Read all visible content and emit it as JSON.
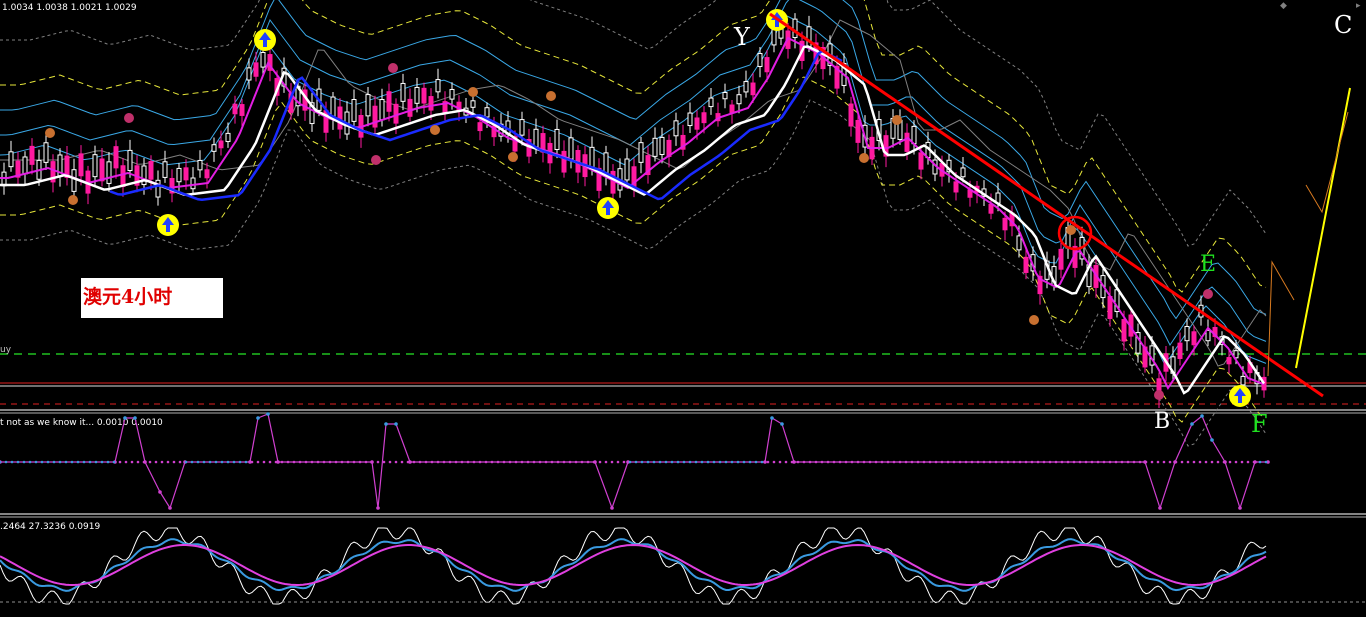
{
  "header": {
    "ohlc": "1.0034 1.0038 1.0021 1.0029"
  },
  "annotation_box": {
    "label": "澳元4小时"
  },
  "wave_labels": {
    "Y": "Y",
    "C": "C",
    "E": "E",
    "B": "B",
    "F": "F"
  },
  "level_label": "uy",
  "indicator1": {
    "title": "t not as we know it...  0.0010 0.0010"
  },
  "indicator2": {
    "title": ".2464 27.3236 0.0919"
  },
  "colors": {
    "bull_candle": "#ffffff",
    "bear_candle": "#ff1aa0",
    "ma_white": "#ffffff",
    "ma_magenta": "#e21ee2",
    "ma_blue": "#1a2bff",
    "band_yellow": "#e6e63a",
    "band_cyan": "#3aa8e6",
    "trend_red": "#ff0000",
    "arrow_yellow": "#ffff00",
    "level_green": "#20c020"
  },
  "chart_data": {
    "type": "candlestick",
    "symbol": "AUD 4H",
    "price_range": [
      0.9975,
      1.0075
    ],
    "candles": [
      [
        1.0035,
        1.0042,
        1.0028,
        1.0032
      ],
      [
        1.0032,
        1.004,
        1.0026,
        1.0036
      ],
      [
        1.0036,
        1.0044,
        1.003,
        1.0033
      ],
      [
        1.0033,
        1.0038,
        1.0024,
        1.0028
      ],
      [
        1.0028,
        1.0036,
        1.0022,
        1.0034
      ],
      [
        1.0034,
        1.0046,
        1.003,
        1.0042
      ],
      [
        1.0042,
        1.005,
        1.0036,
        1.004
      ],
      [
        1.004,
        1.0047,
        1.003,
        1.0034
      ],
      [
        1.0034,
        1.004,
        1.002,
        1.0024
      ],
      [
        1.0024,
        1.0036,
        1.0018,
        1.0032
      ],
      [
        1.0032,
        1.0046,
        1.0028,
        1.0044
      ],
      [
        1.0044,
        1.0058,
        1.004,
        1.0055
      ],
      [
        1.0055,
        1.0068,
        1.005,
        1.0065
      ],
      [
        1.0065,
        1.007,
        1.0048,
        1.0052
      ],
      [
        1.0052,
        1.0058,
        1.004,
        1.0046
      ],
      [
        1.0046,
        1.0054,
        1.0036,
        1.004
      ],
      [
        1.004,
        1.005,
        1.0034,
        1.0047
      ],
      [
        1.0047,
        1.0056,
        1.0042,
        1.0053
      ],
      [
        1.0053,
        1.0058,
        1.0042,
        1.0046
      ],
      [
        1.0046,
        1.0052,
        1.004,
        1.0049
      ],
      [
        1.0049,
        1.0054,
        1.0038,
        1.0041
      ],
      [
        1.0041,
        1.0048,
        1.0036,
        1.0044
      ],
      [
        1.0044,
        1.005,
        1.0038,
        1.0039
      ],
      [
        1.0039,
        1.0046,
        1.0032,
        1.0035
      ],
      [
        1.0035,
        1.0044,
        1.003,
        1.0042
      ],
      [
        1.0042,
        1.0048,
        1.0036,
        1.0038
      ],
      [
        1.0038,
        1.0044,
        1.0026,
        1.003
      ],
      [
        1.003,
        1.0038,
        1.0022,
        1.0026
      ],
      [
        1.0026,
        1.0036,
        1.0022,
        1.0033
      ],
      [
        1.0033,
        1.0044,
        1.003,
        1.0042
      ],
      [
        1.0042,
        1.005,
        1.0038,
        1.0047
      ],
      [
        1.0047,
        1.0054,
        1.0044,
        1.0052
      ],
      [
        1.0052,
        1.0062,
        1.0048,
        1.0058
      ],
      [
        1.0058,
        1.0068,
        1.0055,
        1.0066
      ],
      [
        1.0066,
        1.0072,
        1.0056,
        1.006
      ],
      [
        1.006,
        1.0066,
        1.005,
        1.0056
      ],
      [
        1.0056,
        1.006,
        1.0036,
        1.004
      ],
      [
        1.004,
        1.0046,
        1.003,
        1.0036
      ],
      [
        1.0036,
        1.0042,
        1.0028,
        1.0032
      ],
      [
        1.0032,
        1.0038,
        1.0022,
        1.0026
      ],
      [
        1.0026,
        1.003,
        1.0014,
        1.0018
      ],
      [
        1.0018,
        1.0026,
        1.0012,
        1.0022
      ],
      [
        1.0022,
        1.0028,
        1.0008,
        1.0012
      ],
      [
        1.0012,
        1.0022,
        1.0006,
        1.0018
      ],
      [
        1.0018,
        1.0022,
        1.0004,
        1.0008
      ],
      [
        1.0008,
        1.0014,
        0.9998,
        1.0002
      ],
      [
        1.0002,
        1.0008,
        0.9994,
        0.9998
      ],
      [
        0.9998,
        1.001,
        0.9992,
        1.0006
      ],
      [
        1.0006,
        1.0014,
        0.9996,
        1.0
      ],
      [
        1.0,
        1.0006,
        0.9988,
        0.9992
      ],
      [
        0.9992,
        1.0002,
        0.9986,
        0.9996
      ],
      [
        0.9996,
        1.001,
        0.9992,
        1.0006
      ],
      [
        1.0006,
        1.0012,
        0.9996,
        0.9998
      ],
      [
        0.9998,
        1.0004,
        0.9988,
        0.999
      ],
      [
        0.999,
        0.9998,
        0.9984,
        0.9986
      ]
    ],
    "trendline": {
      "from": [
        1.0072
      ],
      "to": [
        0.9978
      ]
    },
    "indicator1": {
      "type": "step",
      "values": [
        0,
        0,
        1,
        -1,
        0,
        1,
        0,
        0,
        0,
        -1,
        0,
        0,
        1,
        0,
        0,
        0,
        0,
        0,
        0,
        0,
        0,
        0,
        -1,
        -0.5,
        1,
        0,
        -1
      ]
    },
    "indicator2": {
      "type": "oscillator",
      "series": [
        {
          "name": "white"
        },
        {
          "name": "blue"
        },
        {
          "name": "magenta"
        }
      ]
    }
  }
}
